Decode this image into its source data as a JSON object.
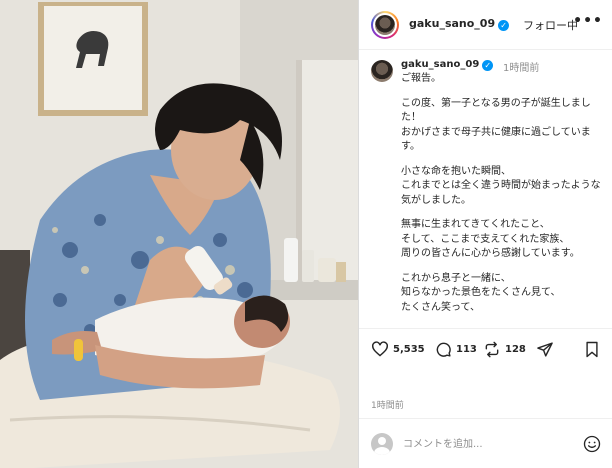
{
  "post": {
    "username": "gaku_sano_09",
    "follow_label": "フォロー中",
    "more_label": "•••",
    "verified_mark": "✓"
  },
  "caption": {
    "username": "gaku_sano_09",
    "time": "1時間前",
    "paragraphs": [
      "ご報告。",
      "この度、第一子となる男の子が誕生しました！\nおかげさまで母子共に健康に過ごしています。",
      "小さな命を抱いた瞬間、\nこれまでとは全く違う時間が始まったような気がしました。",
      "無事に生まれてきてくれたこと、\nそして、ここまで支えてくれた家族、\n周りの皆さんに心から感謝しています。",
      "これから息子と一緒に、\n知らなかった景色をたくさん見て、\nたくさん笑って、"
    ]
  },
  "actions": {
    "likes": "5,535",
    "comments": "113",
    "reposts": "128"
  },
  "posted_time": "1時間前",
  "comment_input": {
    "placeholder": "コメントを追加..."
  },
  "icons": {
    "like": "heart-icon",
    "comment": "comment-icon",
    "repost": "repost-icon",
    "share": "send-icon",
    "save": "bookmark-icon",
    "emoji": "emoji-icon",
    "more": "more-icon"
  },
  "colors": {
    "verified": "#0095f6",
    "text": "#262626",
    "muted": "#8e8e8e",
    "shirt": "#5b7fa8"
  }
}
